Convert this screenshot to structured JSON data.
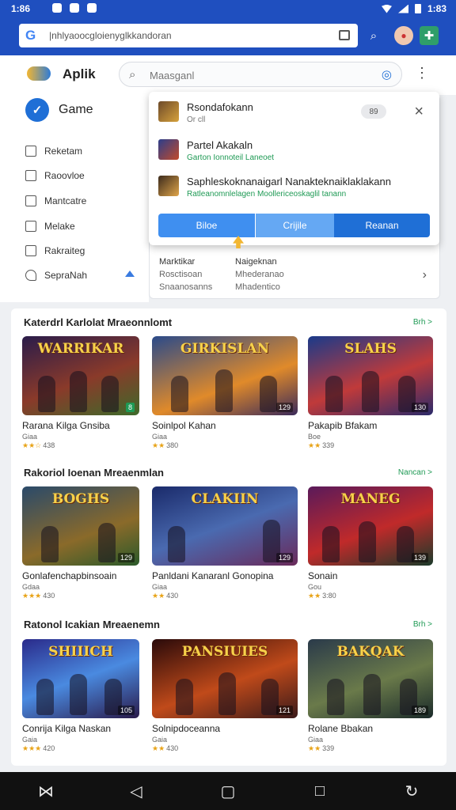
{
  "status_bar": {
    "time": "1:86",
    "right_time": "1:83"
  },
  "browser": {
    "url": "|nhlyaoocgloienyglkkandoran",
    "logo": "G"
  },
  "header": {
    "app_name": "Aplik",
    "search_placeholder": "Maasganl"
  },
  "sidebar": {
    "game_label": "Game",
    "items": [
      "Reketam",
      "Raoovloe",
      "Mantcatre",
      "Melake",
      "Rakraiteg",
      "SepraNah"
    ]
  },
  "popup": {
    "items": [
      {
        "title": "Rsondafokann",
        "sub": "Or cll"
      },
      {
        "title": "Partel Akakaln",
        "sub": "Garton Ionnoteil Laneoet"
      },
      {
        "title": "Saphleskoknanaigarl Nanakteknaiklaklakann",
        "sub": "Ratleanomnlelagen Moollericeoskaglil tanann"
      }
    ],
    "badge": "89",
    "close_icon": "×",
    "buttons": [
      "Biloe",
      "Crijile",
      "Reanan"
    ]
  },
  "behind_card": {
    "col1": [
      "Marktikar",
      "Rosctisoan",
      "Snaanosanns"
    ],
    "col2": [
      "Naigeknan",
      "Mhederanao",
      "Mhadentico"
    ]
  },
  "sections": [
    {
      "title": "Katerdrl Karlolat Mraeonnlomt",
      "more": "Brh >",
      "cards": [
        {
          "art_text": "WARRIKAR",
          "title": "Rarana Kilga Gnsiba",
          "sub": "Giaa",
          "stars": "★★☆",
          "rating_count": "438",
          "badge": "8"
        },
        {
          "art_text": "GIRKISLAN",
          "title": "Soinlpol Kahan",
          "sub": "Giaa",
          "stars": "★★",
          "rating_count": "380",
          "badge": "129"
        },
        {
          "art_text": "SLAHS",
          "title": "Pakapib Bfakam",
          "sub": "Boe",
          "stars": "★★",
          "rating_count": "339",
          "badge": "130"
        }
      ]
    },
    {
      "title": "Rakoriol Ioenan Mreaenmlan",
      "more": "Nancan >",
      "cards": [
        {
          "art_text": "BOGHS",
          "title": "Gonlafenchapbinsoain",
          "sub": "Gdaa",
          "stars": "★★★",
          "rating_count": "430",
          "badge": "129"
        },
        {
          "art_text": "CLAKIIN",
          "title": "Panldani Kanaranl Gonopina",
          "sub": "Giaa",
          "stars": "★★",
          "rating_count": "430",
          "badge": "129"
        },
        {
          "art_text": "MANEG",
          "title": "Sonain",
          "sub": "Gou",
          "stars": "★★",
          "rating_count": "3:80",
          "badge": "139"
        }
      ]
    },
    {
      "title": "Ratonol Icakian Mreaenemn",
      "more": "Brh >",
      "cards": [
        {
          "art_text": "SHIIICH",
          "title": "Conrija Kilga Naskan",
          "sub": "Gaia",
          "stars": "★★★",
          "rating_count": "420",
          "badge": "105"
        },
        {
          "art_text": "PANSIUIES",
          "title": "Solnipdoceanna",
          "sub": "Gaia",
          "stars": "★★",
          "rating_count": "430",
          "badge": "121"
        },
        {
          "art_text": "BAKQAK",
          "title": "Rolane Bbakan",
          "sub": "Giaa",
          "stars": "★★",
          "rating_count": "339",
          "badge": "189"
        }
      ]
    }
  ]
}
